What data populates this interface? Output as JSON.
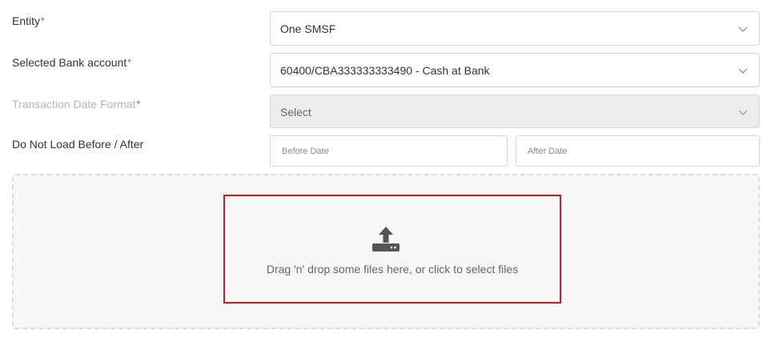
{
  "form": {
    "entity": {
      "label": "Entity",
      "required_mark": "*",
      "value": "One SMSF"
    },
    "bank_account": {
      "label": "Selected Bank account",
      "required_mark": "*",
      "value": "60400/CBA333333333490 - Cash at Bank"
    },
    "date_format": {
      "label": "Transaction Date Format",
      "required_mark": "*",
      "value": "Select"
    },
    "load_range": {
      "label": "Do Not Load Before / After",
      "before_placeholder": "Before Date",
      "after_placeholder": "After Date"
    }
  },
  "upload": {
    "text": "Drag 'n' drop some files here, or click to select files"
  },
  "colors": {
    "required": "#e0443c",
    "highlight_border": "#d0191e",
    "icon": "#555555"
  }
}
